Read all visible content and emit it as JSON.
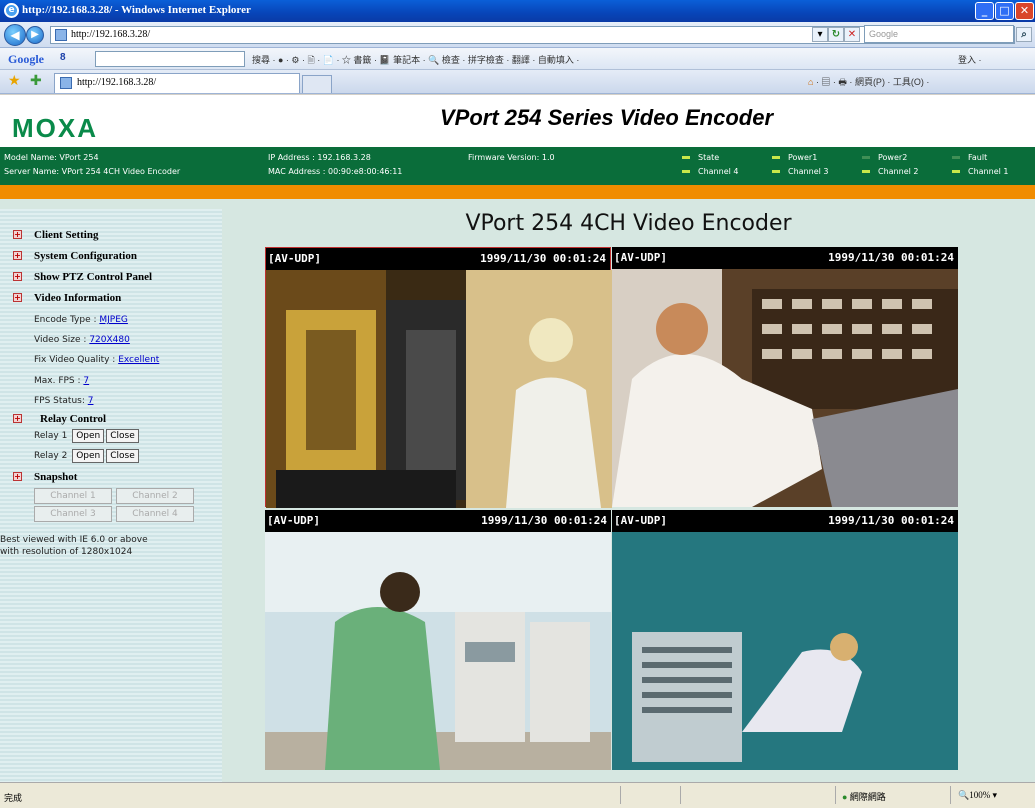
{
  "window": {
    "title": "http://192.168.3.28/ - Windows Internet Explorer"
  },
  "address_bar": {
    "url": "http://192.168.3.28/",
    "search_placeholder": "Google"
  },
  "google_toolbar": {
    "logo": "Google",
    "search_value": "8",
    "items": "搜尋 · ● · ⚙ · 🗎 · 📄 · ☆ 書籤 · 📓 筆記本 · 🔍 檢查 · 拼字檢查 · 翻譯 · 自動填入 ·",
    "right": "登入 ·"
  },
  "tab_bar": {
    "tab_title": "http://192.168.3.28/",
    "right_tools": "網頁(P) · 工具(O) ·"
  },
  "header": {
    "logo": "MOXA",
    "product_title_italic": "VPort",
    "product_title_rest": " 254 Series Video Encoder"
  },
  "info": {
    "model_name": "Model Name: VPort 254",
    "server_name": "Server Name: VPort 254 4CH Video Encoder",
    "ip_address": "IP Address : 192.168.3.28",
    "mac_address": "MAC Address : 00:90:e8:00:46:11",
    "firmware": "Firmware Version: 1.0"
  },
  "status_leds": [
    {
      "label": "State",
      "on": true
    },
    {
      "label": "Power1",
      "on": true
    },
    {
      "label": "Power2",
      "on": false
    },
    {
      "label": "Fault",
      "on": false
    },
    {
      "label": "Channel 4",
      "on": true
    },
    {
      "label": "Channel 3",
      "on": true
    },
    {
      "label": "Channel 2",
      "on": true
    },
    {
      "label": "Channel 1",
      "on": true
    }
  ],
  "sidebar": {
    "client_setting": "Client Setting",
    "system_configuration": "System Configuration",
    "show_ptz": "Show PTZ Control Panel",
    "video_information": "Video Information",
    "encode_type_label": "Encode Type : ",
    "encode_type_value": "MJPEG",
    "video_size_label": "Video Size : ",
    "video_size_value": "720X480",
    "fix_quality_label": "Fix Video Quality : ",
    "fix_quality_value": "Excellent",
    "max_fps_label": "Max. FPS : ",
    "max_fps_value": "7",
    "fps_status_label": "FPS Status: ",
    "fps_status_value": "7",
    "relay_control": "Relay Control",
    "relay1": "Relay 1",
    "relay2": "Relay 2",
    "open": "Open",
    "close": "Close",
    "snapshot": "Snapshot",
    "channel1": "Channel 1",
    "channel2": "Channel 2",
    "channel3": "Channel 3",
    "channel4": "Channel 4",
    "note_line1": "Best viewed with IE 6.0 or above",
    "note_line2": "with resolution of 1280x1024"
  },
  "main": {
    "title": "VPort 254 4CH Video Encoder",
    "videos": [
      {
        "label": "[AV-UDP]",
        "timestamp": "1999/11/30 00:01:24"
      },
      {
        "label": "[AV-UDP]",
        "timestamp": "1999/11/30 00:01:24"
      },
      {
        "label": "[AV-UDP]",
        "timestamp": "1999/11/30 00:01:24"
      },
      {
        "label": "[AV-UDP]",
        "timestamp": "1999/11/30 00:01:24"
      }
    ]
  },
  "statusbar": {
    "text": "完成",
    "zone": "網際網路",
    "zoom": "100%"
  },
  "colors": {
    "moxa_green": "#0a6d3a",
    "orange_strip": "#f08c00",
    "led_on": "#c8e84a",
    "led_off": "#3f8f55"
  }
}
